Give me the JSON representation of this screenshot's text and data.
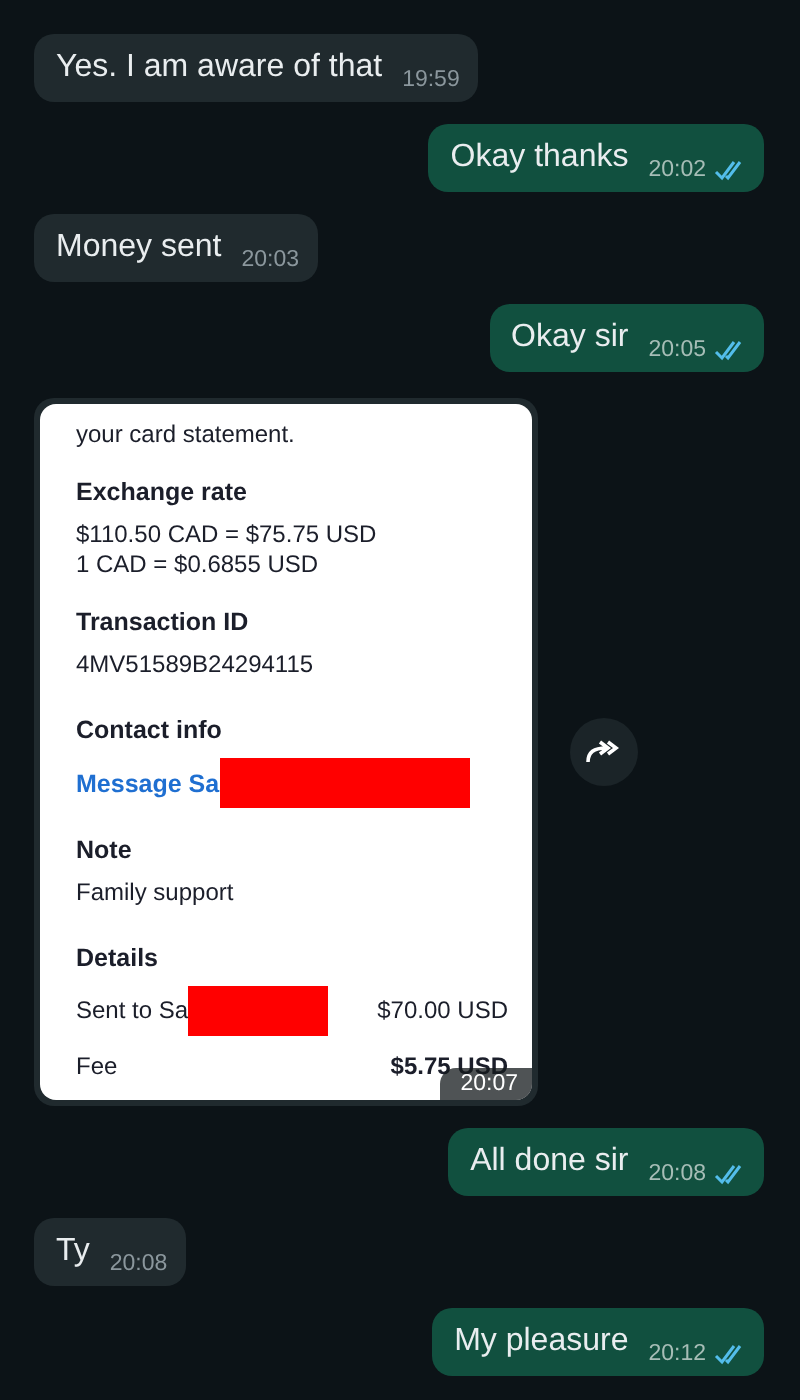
{
  "messages": [
    {
      "kind": "text",
      "outgoing": false,
      "text": "Yes. I am aware of that",
      "time": "19:59"
    },
    {
      "kind": "text",
      "outgoing": true,
      "text": "Okay thanks",
      "time": "20:02",
      "read": true
    },
    {
      "kind": "text",
      "outgoing": false,
      "text": "Money sent",
      "time": "20:03"
    },
    {
      "kind": "text",
      "outgoing": true,
      "text": "Okay sir",
      "time": "20:05",
      "read": true
    },
    {
      "kind": "image",
      "outgoing": false,
      "time": "20:07",
      "document": {
        "intro": "your card statement.",
        "sections": [
          {
            "heading": "Exchange rate",
            "lines": [
              "$110.50 CAD = $75.75 USD",
              "1 CAD = $0.6855 USD"
            ]
          },
          {
            "heading": "Transaction ID",
            "lines": [
              "4MV51589B24294115"
            ]
          },
          {
            "heading": "Contact info",
            "link": "Message Sa"
          },
          {
            "heading": "Note",
            "lines": [
              "Family support"
            ]
          },
          {
            "heading": "Details",
            "rows": [
              {
                "label": "Sent to Sa",
                "value": "$70.00 USD",
                "redacted": true
              },
              {
                "label": "Fee",
                "value": "$5.75 USD",
                "redacted": false
              }
            ]
          }
        ]
      }
    },
    {
      "kind": "text",
      "outgoing": true,
      "text": "All done sir",
      "time": "20:08",
      "read": true
    },
    {
      "kind": "text",
      "outgoing": false,
      "text": "Ty",
      "time": "20:08"
    },
    {
      "kind": "text",
      "outgoing": true,
      "text": "My pleasure",
      "time": "20:12",
      "read": true
    }
  ]
}
